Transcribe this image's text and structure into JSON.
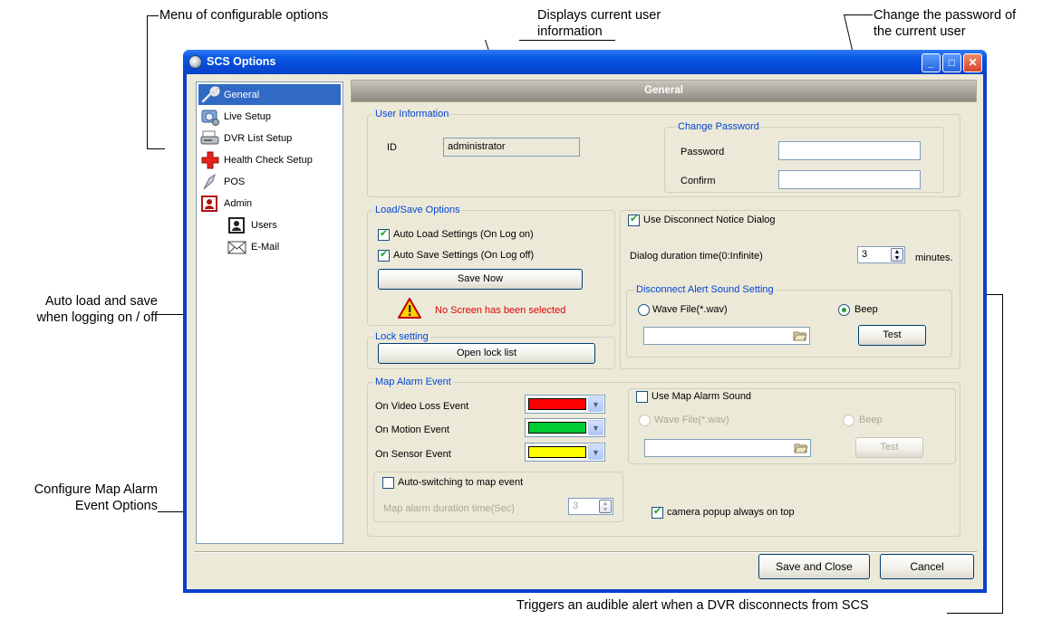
{
  "callouts": {
    "menu": "Menu of configurable options",
    "user_info_l1": "Displays current user",
    "user_info_l2": "information",
    "password_l1": "Change the password of",
    "password_l2": "the current user",
    "autoload_l1": "Auto load and save",
    "autoload_l2": "when logging on / off",
    "map_l1": "Configure Map Alarm",
    "map_l2": "Event Options",
    "dvr_alert": "Triggers an audible alert when a DVR disconnects from SCS"
  },
  "window": {
    "title": "SCS Options",
    "min_glyph": "_",
    "max_glyph": "□",
    "close_glyph": "✕"
  },
  "nav": {
    "items": [
      {
        "label": "General",
        "icon": "wrench-icon"
      },
      {
        "label": "Live Setup",
        "icon": "live-setup-icon"
      },
      {
        "label": "DVR List Setup",
        "icon": "dvr-list-icon"
      },
      {
        "label": "Health Check Setup",
        "icon": "health-check-icon"
      },
      {
        "label": "POS",
        "icon": "pos-icon"
      },
      {
        "label": "Admin",
        "icon": "admin-icon"
      },
      {
        "label": "Users",
        "icon": "users-icon"
      },
      {
        "label": "E-Mail",
        "icon": "email-icon"
      }
    ]
  },
  "header": {
    "title": "General"
  },
  "user_info": {
    "legend": "User Information",
    "id_label": "ID",
    "id_value": "administrator"
  },
  "change_password": {
    "legend": "Change Password",
    "password_label": "Password",
    "password_value": "",
    "confirm_label": "Confirm",
    "confirm_value": ""
  },
  "load_save": {
    "legend": "Load/Save Options",
    "auto_load": "Auto Load Settings (On Log on)",
    "auto_load_checked": true,
    "auto_save": "Auto Save Settings (On Log off)",
    "auto_save_checked": true,
    "save_now": "Save Now",
    "warning": "No Screen has been selected"
  },
  "lock": {
    "legend": "Lock setting",
    "open_lock_list": "Open lock list"
  },
  "disconnect": {
    "use_notice": "Use Disconnect Notice Dialog",
    "use_notice_checked": true,
    "duration_label": "Dialog duration time(0:Infinite)",
    "duration_value": "3",
    "duration_unit": "minutes.",
    "sound_legend": "Disconnect Alert Sound Setting",
    "wave_label": "Wave File(*.wav)",
    "beep_label": "Beep",
    "selected": "beep",
    "file_value": "",
    "test": "Test"
  },
  "map_alarm": {
    "legend": "Map Alarm Event",
    "events": [
      {
        "label": "On Video Loss Event",
        "color": "#ff0000"
      },
      {
        "label": "On Motion Event",
        "color": "#00cc33"
      },
      {
        "label": "On Sensor Event",
        "color": "#ffff00"
      }
    ],
    "use_sound": "Use Map Alarm Sound",
    "use_sound_checked": false,
    "wave_label": "Wave File(*.wav)",
    "beep_label": "Beep",
    "file_value": "",
    "test": "Test",
    "auto_switch": "Auto-switching to map event",
    "auto_switch_checked": false,
    "duration_label": "Map alarm duration time(Sec)",
    "duration_value": "3",
    "popup_top": "camera popup always on top",
    "popup_top_checked": true
  },
  "footer": {
    "save_close": "Save and Close",
    "cancel": "Cancel"
  }
}
